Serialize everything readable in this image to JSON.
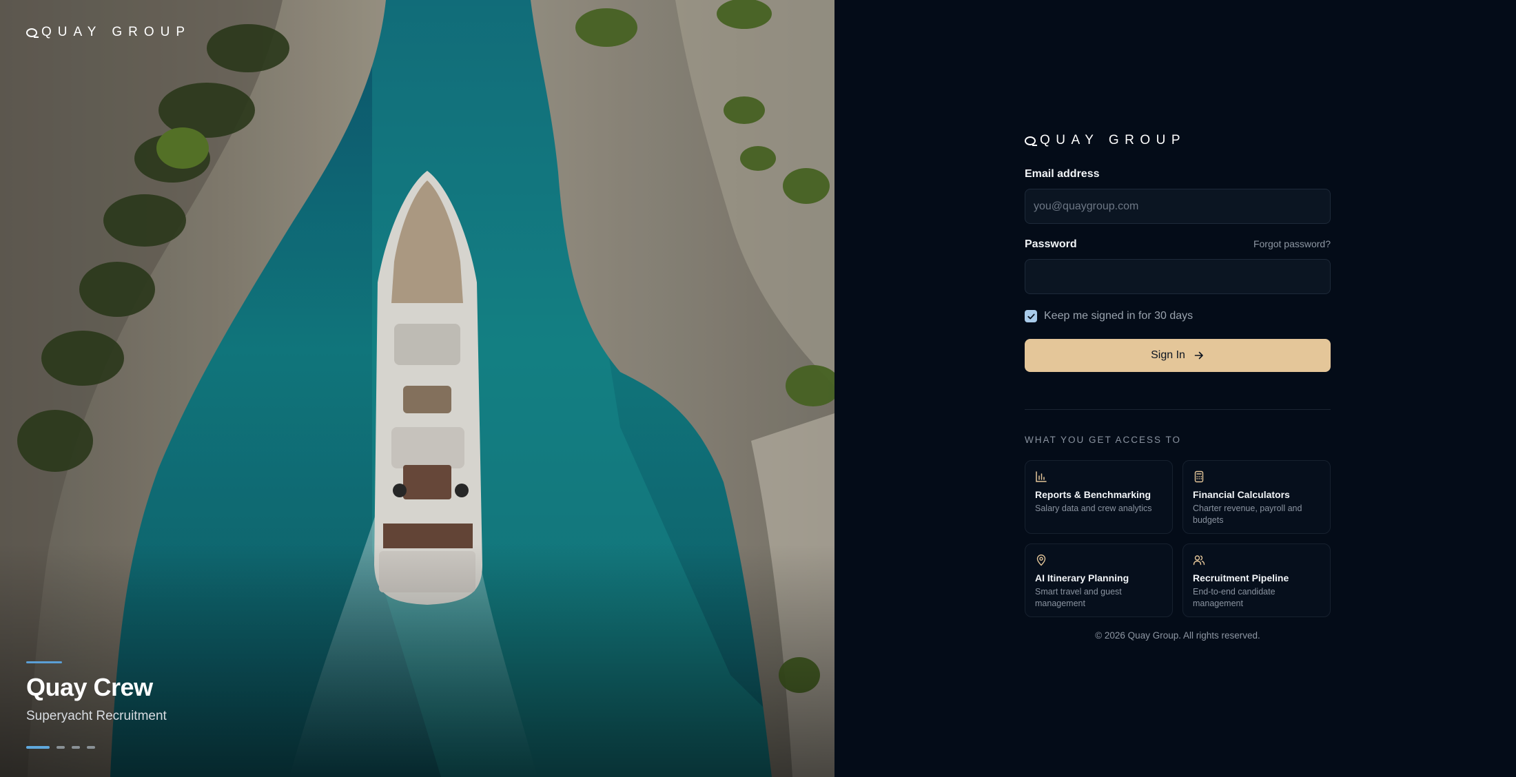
{
  "brand": {
    "logo_text": "QUAY GROUP"
  },
  "hero": {
    "title": "Quay Crew",
    "subtitle": "Superyacht Recruitment",
    "slides_total": 4,
    "slide_active": 1
  },
  "form": {
    "email_label": "Email address",
    "email_placeholder": "you@quaygroup.com",
    "email_value": "",
    "password_label": "Password",
    "password_value": "",
    "forgot_label": "Forgot password?",
    "remember_label": "Keep me signed in for 30 days",
    "remember_checked": true,
    "signin_label": "Sign In"
  },
  "access": {
    "heading": "WHAT YOU GET ACCESS TO",
    "items": [
      {
        "icon": "bar-chart-icon",
        "title": "Reports & Benchmarking",
        "desc": "Salary data and crew analytics"
      },
      {
        "icon": "calculator-icon",
        "title": "Financial Calculators",
        "desc": "Charter revenue, payroll and budgets"
      },
      {
        "icon": "map-pin-icon",
        "title": "AI Itinerary Planning",
        "desc": "Smart travel and guest management"
      },
      {
        "icon": "users-icon",
        "title": "Recruitment Pipeline",
        "desc": "End-to-end candidate management"
      }
    ]
  },
  "footer": {
    "copyright": "© 2026 Quay Group. All rights reserved."
  },
  "colors": {
    "panel_bg": "#040c18",
    "accent_button": "#e4c699",
    "accent_blue": "#5fa8dd",
    "checkbox": "#a9cbea"
  }
}
